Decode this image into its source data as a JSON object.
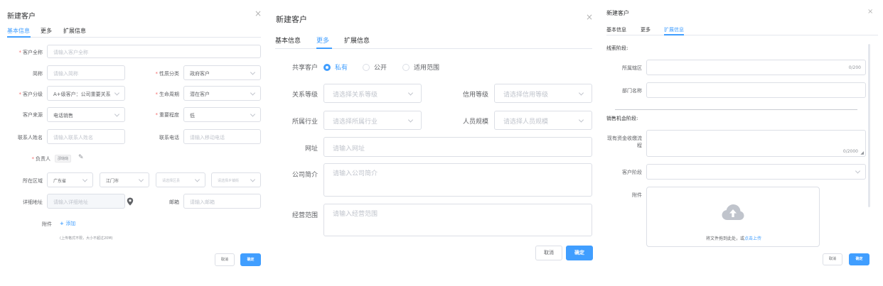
{
  "colors": {
    "accent": "#409eff",
    "required": "#f56c6c",
    "border": "#dcdfe6",
    "placeholder": "#c0c4cc"
  },
  "p1": {
    "title": "新建客户",
    "close": "×",
    "tabs": [
      "基本信息",
      "更多",
      "扩展信息"
    ],
    "active_tab": 0,
    "labels": {
      "full_name": "客户全称",
      "short_name": "简称",
      "nature": "性质分类",
      "level": "客户分级",
      "lifecycle": "生命周期",
      "source": "客户来源",
      "importance": "重要程度",
      "contact": "联系人姓名",
      "phone": "联系电话",
      "owner": "负责人",
      "region": "所在区域",
      "address": "详细地址",
      "email": "邮箱",
      "attachment": "附件"
    },
    "values": {
      "full_name": "请输入客户全称",
      "short_name": "请输入简称",
      "nature": "政府客户",
      "level": "A+级客户：公司重要关系",
      "lifecycle": "潜在客户",
      "source": "电话销售",
      "importance": "低",
      "contact": "请输入联系人姓名",
      "phone": "请输入移动电话",
      "owner_tag": "邵璐璐",
      "province": "广东省",
      "city": "江门市",
      "district": "请选择区县",
      "town": "请选择乡镇街",
      "address": "请输入详细地址",
      "email": "请输入邮箱",
      "add": "添加",
      "hint": "(上传格式不限，大小不超过20M)"
    },
    "cancel": "取消",
    "ok": "确定"
  },
  "p2": {
    "title": "新建客户",
    "close": "×",
    "tabs": [
      "基本信息",
      "更多",
      "扩展信息"
    ],
    "active_tab": 1,
    "share_label": "共享客户",
    "share_options": [
      "私有",
      "公开",
      "适用范围"
    ],
    "share_selected": 0,
    "labels": {
      "relation": "关系等级",
      "credit": "信用等级",
      "industry": "所属行业",
      "staff": "人员规模",
      "website": "网址",
      "intro": "公司简介",
      "scope": "经营范围"
    },
    "placeholders": {
      "relation": "请选择关系等级",
      "credit": "请选择信用等级",
      "industry": "请选择所属行业",
      "staff": "请选择人员规模",
      "website": "请输入网址",
      "intro": "请输入公司简介",
      "scope": "请输入经营范围"
    },
    "cancel": "取消",
    "ok": "确定"
  },
  "p3": {
    "title": "新建客户",
    "close": "×",
    "tabs": [
      "基本信息",
      "更多",
      "扩展信息"
    ],
    "active_tab": 2,
    "section1": "线索阶段:",
    "section2": "销售机会阶段:",
    "labels": {
      "district": "所属辖区",
      "dept": "部门名称",
      "flow": "现有资金收缴流程",
      "stage": "客户阶段",
      "attachment": "附件"
    },
    "counter1": "0/200",
    "counter2": "0/2000",
    "upload_text": "将文件拖到此处，或",
    "upload_link": "点击上传",
    "cancel": "取消",
    "ok": "确定"
  }
}
